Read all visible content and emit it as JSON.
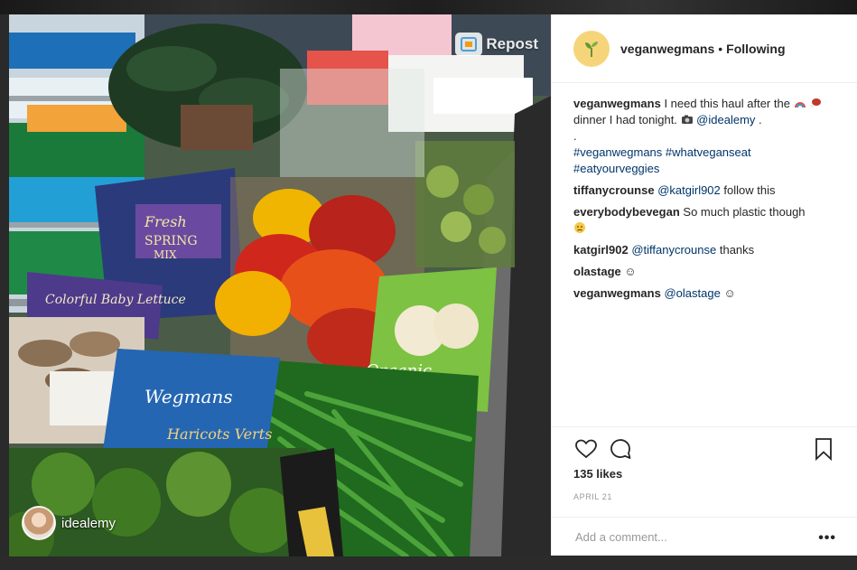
{
  "photo": {
    "repost_label": "Repost",
    "credit_name": "idealemy"
  },
  "post": {
    "username": "veganwegmans",
    "separator": "•",
    "follow_status": "Following"
  },
  "caption": {
    "user": "veganwegmans",
    "text_a": "I need this haul after the",
    "text_b": "dinner I had tonight.",
    "mention": "@idealemy",
    "end": ".",
    "dot_line": ".",
    "hashtags_line1_a": "#veganwegmans",
    "hashtags_line1_b": "#whatveganseat",
    "hashtags_line2": "#eatyourveggies"
  },
  "comments": [
    {
      "user": "tiffanycrounse",
      "mention": "@katgirl902",
      "text": "follow this"
    },
    {
      "user": "everybodybevegan",
      "text": "So much plastic though",
      "emoji": "worried-face-icon"
    },
    {
      "user": "katgirl902",
      "mention": "@tiffanycrounse",
      "text": "thanks"
    },
    {
      "user": "olastage",
      "text": "☺"
    },
    {
      "user": "veganwegmans",
      "mention": "@olastage",
      "text": "☺"
    }
  ],
  "likes": "135 likes",
  "date": "APRIL 21",
  "add_comment": {
    "placeholder": "Add a comment..."
  },
  "more": "•••",
  "colors": {
    "link": "#003569",
    "text": "#262626",
    "muted": "#999999",
    "avatar_bg": "#f6d57a"
  }
}
